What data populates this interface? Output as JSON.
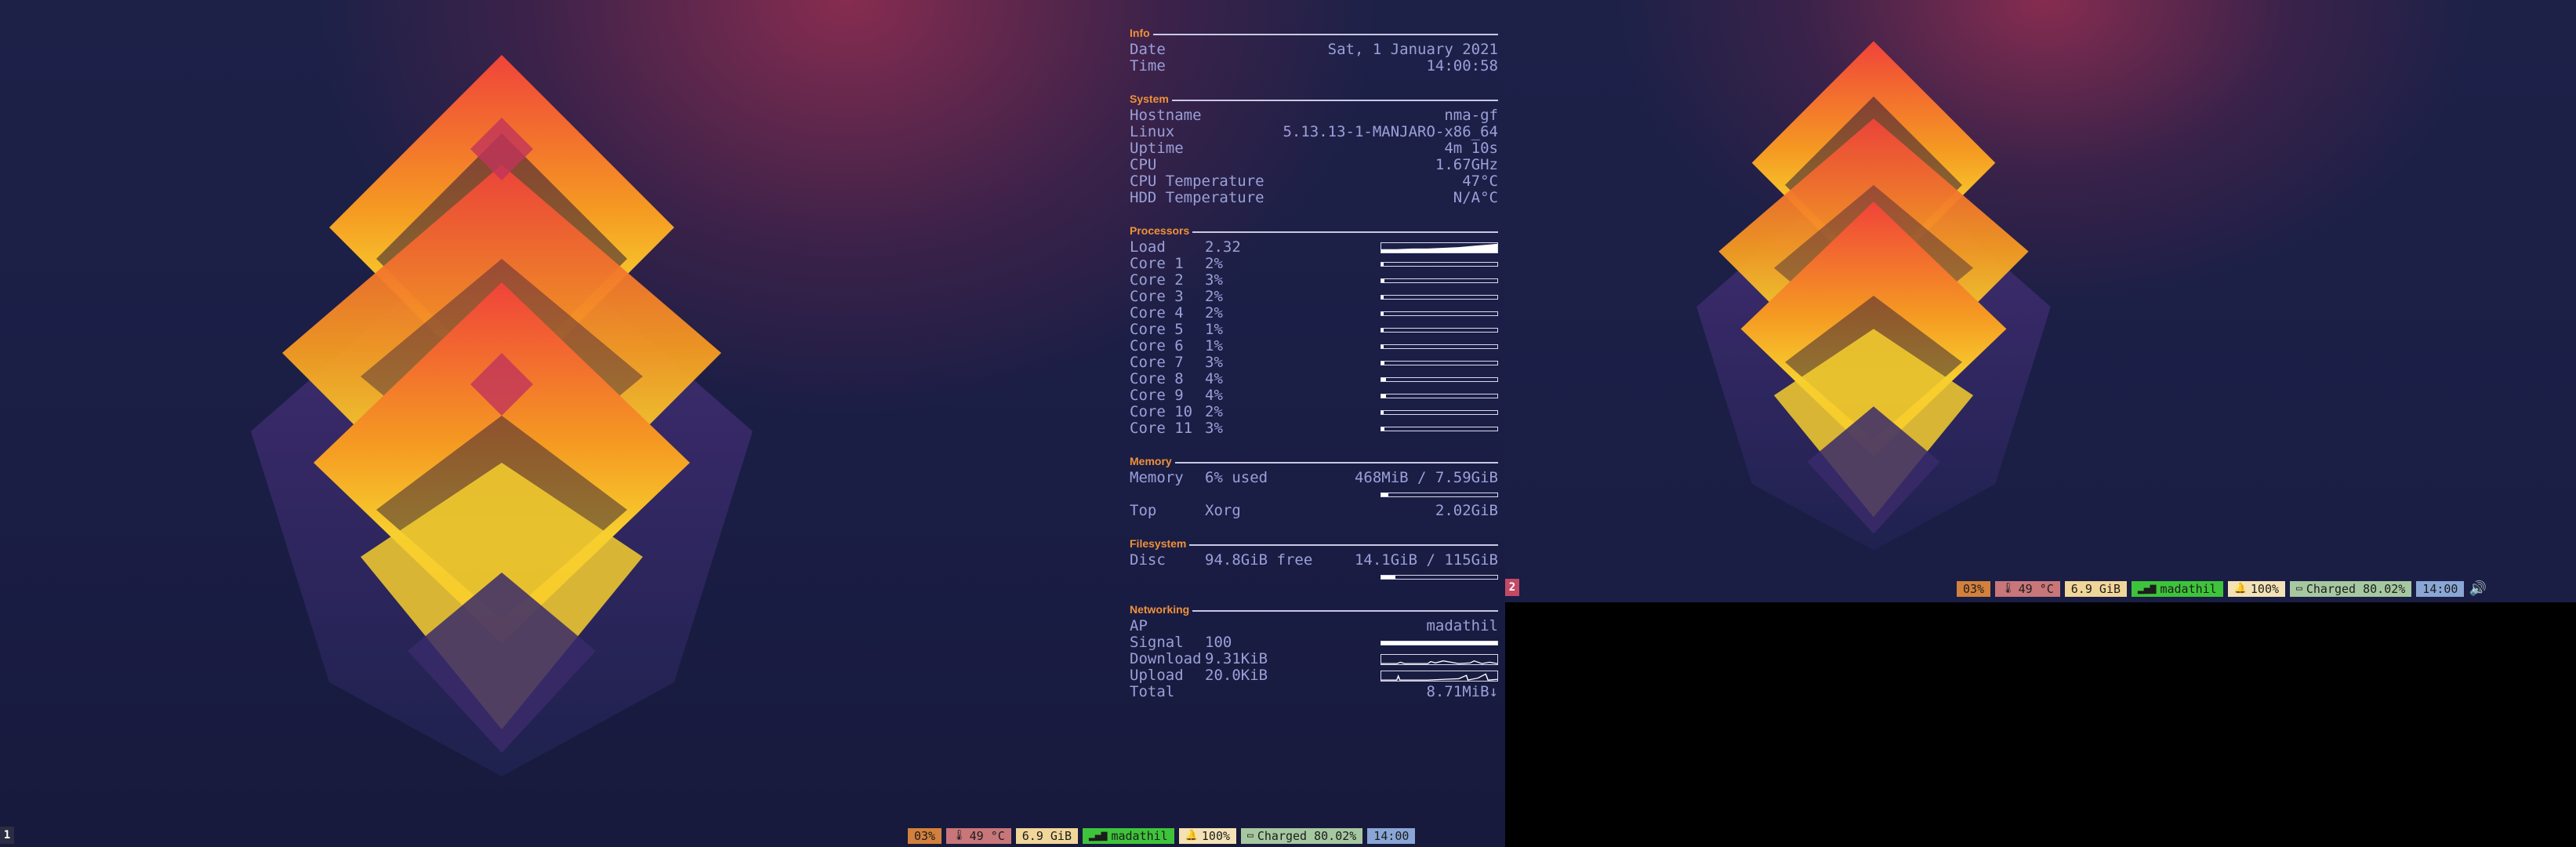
{
  "conky": {
    "info": {
      "title": "Info",
      "date_label": "Date",
      "date_value": "Sat, 1 January 2021",
      "time_label": "Time",
      "time_value": "14:00:58"
    },
    "system": {
      "title": "System",
      "rows": [
        {
          "label": "Hostname",
          "value": "nma-gf"
        },
        {
          "label": "Linux",
          "value": "5.13.13-1-MANJARO-x86_64"
        },
        {
          "label": "Uptime",
          "value": "4m 10s"
        },
        {
          "label": "CPU",
          "value": "1.67GHz"
        },
        {
          "label": "CPU Temperature",
          "value": "47°C"
        },
        {
          "label": "HDD Temperature",
          "value": "N/A°C"
        }
      ]
    },
    "processors": {
      "title": "Processors",
      "load_label": "Load",
      "load_value": "2.32",
      "cores": [
        {
          "label": "Core 1",
          "pct": "2%",
          "level": 0.02
        },
        {
          "label": "Core 2",
          "pct": "3%",
          "level": 0.03
        },
        {
          "label": "Core 3",
          "pct": "2%",
          "level": 0.02
        },
        {
          "label": "Core 4",
          "pct": "2%",
          "level": 0.02
        },
        {
          "label": "Core 5",
          "pct": "1%",
          "level": 0.01
        },
        {
          "label": "Core 6",
          "pct": "1%",
          "level": 0.01
        },
        {
          "label": "Core 7",
          "pct": "3%",
          "level": 0.03
        },
        {
          "label": "Core 8",
          "pct": "4%",
          "level": 0.04
        },
        {
          "label": "Core 9",
          "pct": "4%",
          "level": 0.04
        },
        {
          "label": "Core 10",
          "pct": "2%",
          "level": 0.02
        },
        {
          "label": "Core 11",
          "pct": "3%",
          "level": 0.03
        }
      ]
    },
    "memory": {
      "title": "Memory",
      "label": "Memory",
      "used": "6% used",
      "amount": "468MiB / 7.59GiB",
      "level": 0.06,
      "top_label": "Top",
      "top_proc": "Xorg",
      "top_value": "2.02GiB"
    },
    "filesystem": {
      "title": "Filesystem",
      "label": "Disc",
      "free": "94.8GiB free",
      "amount": "14.1GiB / 115GiB",
      "level": 0.12
    },
    "networking": {
      "title": "Networking",
      "ap_label": "AP",
      "ap_value": "madathil",
      "signal_label": "Signal",
      "signal_value": "100",
      "signal_level": 1.0,
      "download_label": "Download",
      "download_value": "9.31KiB",
      "upload_label": "Upload",
      "upload_value": "20.0KiB",
      "total_label": "Total",
      "total_value": "8.71MiB↓"
    }
  },
  "statusbar": {
    "workspace_1": "1",
    "workspace_2": "2",
    "blocks": {
      "cpu": "03%",
      "temp": "49 °C",
      "mem": "6.9 GiB",
      "wifi": "madathil",
      "volume": "100%",
      "battery": "Charged 80.02%",
      "clock": "14:00"
    }
  },
  "colors": {
    "cpu_block": "#d3803d",
    "temp_block": "#c8767a",
    "mem_block": "#f1d699",
    "wifi_block": "#3ec43a",
    "volume_block": "#f3e2b5",
    "battery_block": "#a6c8a0",
    "clock_block": "#89a6d6",
    "ws_active": "#c34a66",
    "ws_inactive": "#2b2e42",
    "accent": "#f0913a"
  },
  "icons": {
    "temp": "thermometer-icon",
    "wifi": "wifi-signal-icon",
    "volume": "bell-icon",
    "battery": "battery-icon",
    "speaker": "speaker-icon"
  }
}
